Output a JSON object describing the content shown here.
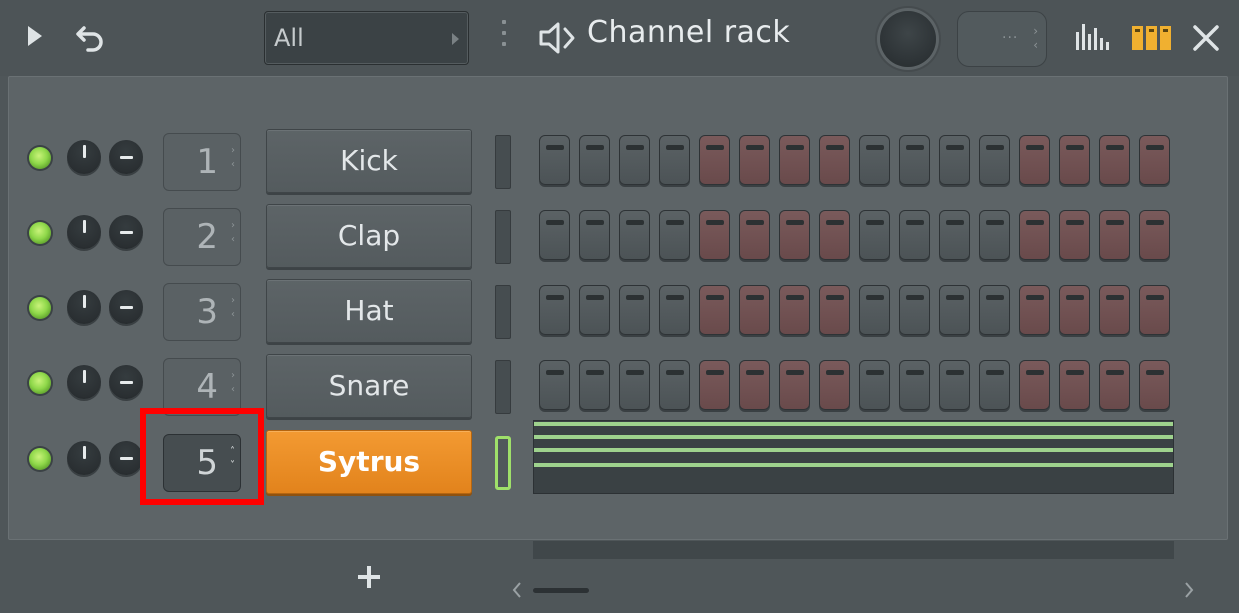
{
  "toolbar": {
    "play_icon": "play-icon",
    "undo_icon": "undo-icon",
    "filter_value": "All",
    "window_title": "Channel rack",
    "pattern_value": "···",
    "icons": [
      "speaker-icon",
      "eq-icon",
      "rack-icon",
      "close-icon"
    ]
  },
  "channels": [
    {
      "route": "1",
      "name": "Kick",
      "selected": false
    },
    {
      "route": "2",
      "name": "Clap",
      "selected": false
    },
    {
      "route": "3",
      "name": "Hat",
      "selected": false
    },
    {
      "route": "4",
      "name": "Snare",
      "selected": false
    },
    {
      "route": "5",
      "name": "Sytrus",
      "selected": true
    }
  ],
  "step_pattern_colors": [
    "g",
    "g",
    "g",
    "g",
    "r",
    "r",
    "r",
    "r",
    "g",
    "g",
    "g",
    "g",
    "r",
    "r",
    "r",
    "r"
  ],
  "colors": {
    "accent": "#e8891f",
    "led": "#8fd84a",
    "highlight": "#ff0000",
    "step_gray": "#55 5c5f",
    "step_red": "#6f5051"
  },
  "footer": {
    "add_icon": "plus-icon"
  }
}
